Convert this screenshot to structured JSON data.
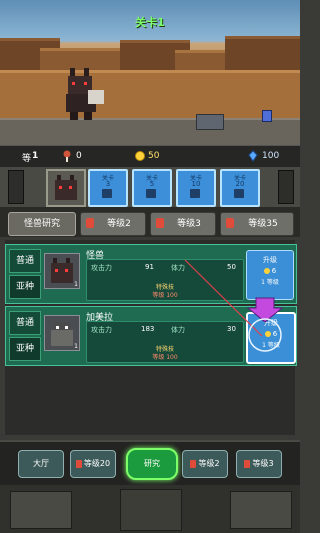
{
  "stage": {
    "title": "关卡1"
  },
  "status": {
    "level_label": "等",
    "level_value": "1",
    "meat": "0",
    "coins": "50",
    "gems": "100"
  },
  "squad": {
    "slots": [
      {
        "kind": "monster"
      },
      {
        "kind": "locked",
        "label": "关卡",
        "num": "3"
      },
      {
        "kind": "locked",
        "label": "关卡",
        "num": "5"
      },
      {
        "kind": "locked",
        "label": "关卡",
        "num": "10"
      },
      {
        "kind": "locked",
        "label": "关卡",
        "num": "20"
      }
    ]
  },
  "tabs": {
    "research": "怪兽研究",
    "t2": "等级2",
    "t3": "等级3",
    "t4": "等级35"
  },
  "rows": [
    {
      "normal": "普通",
      "subspecies": "亚种",
      "name": "怪兽",
      "level": "1",
      "attack_label": "攻击力",
      "attack": "91",
      "hp_label": "体力",
      "hp": "50",
      "skill": "特殊技",
      "skill_level": "等级 100",
      "upgrade": "升级",
      "cost": "6",
      "upgrade_level": "1 等级"
    },
    {
      "normal": "普通",
      "subspecies": "亚种",
      "name": "加美拉",
      "level": "1",
      "attack_label": "攻击力",
      "attack": "183",
      "hp_label": "体力",
      "hp": "30",
      "skill": "特殊技",
      "skill_level": "等级 100",
      "upgrade": "升级",
      "cost": "6",
      "upgrade_level": "1 等级"
    }
  ],
  "nav": {
    "lobby": "大厅",
    "lv20": "等级20",
    "research": "研究",
    "lv2": "等级2",
    "lv3": "等级3"
  },
  "colors": {
    "accent_green": "#7dff6a",
    "upgrade_blue": "#3a8fd6",
    "row_green": "#1f6b52"
  }
}
